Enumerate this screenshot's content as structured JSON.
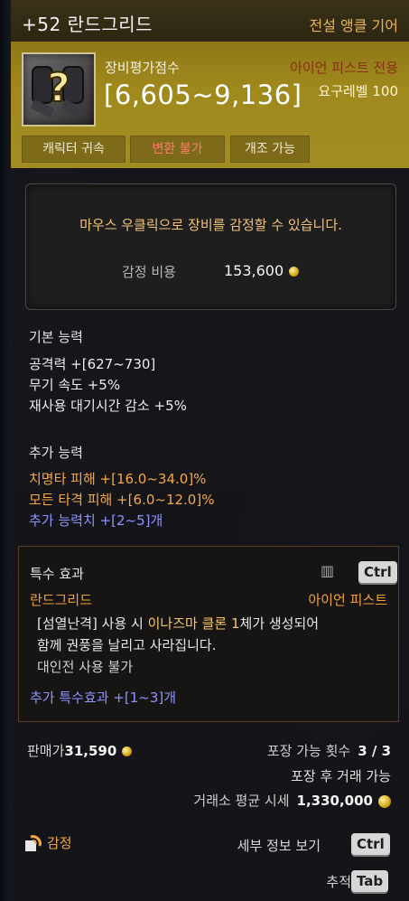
{
  "item": {
    "name": "+52 란드그리드",
    "grade": "전설 앵클 기어",
    "icon": "mystery-gauntlet-icon",
    "score_label": "장비평가점수",
    "score_value": "[6,605~9,136]",
    "class_req": "아이언 피스트 전용",
    "level_req": "요구레벨 100",
    "badges": [
      "캐릭터 귀속",
      "변환 불가",
      "개조 가능"
    ]
  },
  "appraisal": {
    "message": "마우스 우클릭으로 장비를 감정할 수 있습니다.",
    "cost_label": "감정 비용",
    "cost_value": "153,600"
  },
  "basic_stats": {
    "title": "기본 능력",
    "lines": [
      "공격력 +[627~730]",
      "무기 속도 +5%",
      "재사용 대기시간 감소 +5%"
    ]
  },
  "extra_stats": {
    "title": "추가 능력",
    "lines": [
      "치명타 피해 +[16.0~34.0]%",
      "모든 타격 피해 +[6.0~12.0]%",
      "추가 능력치 +[2~5]개"
    ]
  },
  "special": {
    "title": "특수 효과",
    "key": "Ctrl",
    "name": "란드그리드",
    "class": "아이언 피스트",
    "desc_a": "[섬열난격]",
    "desc_b": " 사용 시 ",
    "desc_c": "이나즈마 클론 1",
    "desc_d": "체가 생성되어",
    "desc_2": "함께 권풍을 날리고 사라집니다.",
    "pvp": "대인전 사용 불가",
    "more": "추가 특수효과 +[1~3]개"
  },
  "footer": {
    "sell_label": "판매가",
    "sell_value": "31,590",
    "pack_label": "포장 가능 횟수",
    "pack_value": "3 / 3",
    "pack_after": "포장 후 거래 가능",
    "avg_label": "거래소 평균 시세",
    "avg_value": "1,330,000",
    "appraise": "감정",
    "detail": "세부 정보 보기",
    "detail_key": "Ctrl",
    "track": "추적",
    "track_key": "Tab"
  },
  "colors": {
    "header_bg": "#3a3218",
    "gold_panel": "#a08a1d",
    "grade_text": "#e8b35a",
    "orange_text": "#f3a84a",
    "blue_text": "#8d95ff",
    "red_badge_text": "#ff7a6e"
  }
}
